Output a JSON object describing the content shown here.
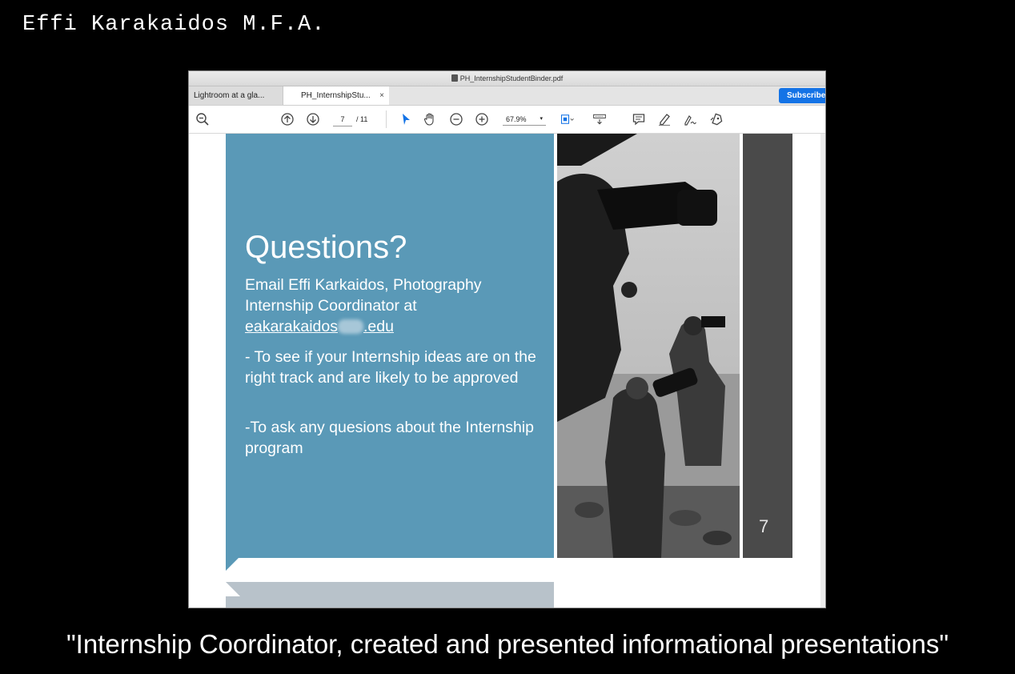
{
  "header_name": "Effi Karakaidos M.F.A.",
  "caption": "\"Internship Coordinator, created and presented informational presentations\"",
  "window": {
    "title": "PH_InternshipStudentBinder.pdf",
    "tabs": [
      {
        "label": "Lightroom at a gla..."
      },
      {
        "label": "PH_InternshipStu...",
        "close": "×"
      }
    ],
    "subscribe_label": "Subscribe"
  },
  "toolbar": {
    "current_page": "7",
    "total_pages": "/ 11",
    "zoom": "67.9%",
    "zoom_dropdown": "▾"
  },
  "slide": {
    "title": "Questions?",
    "email_line_name": "Email Effi Karkaidos",
    "email_line_rest": ", Photography Internship Coordinator at",
    "email_prefix": "eakarakaidos",
    "email_suffix": ".edu",
    "bullet1": "- To see if your Internship ideas are on the right track and are likely to be approved",
    "bullet2": "-To ask any quesions about the Internship program",
    "page_number": "7"
  },
  "colors": {
    "panel_blue": "#5a99b7",
    "subscribe_blue": "#1473e6",
    "dark_bar": "#4a4a4a"
  },
  "icons": [
    "zoom-out-icon",
    "page-up-icon",
    "page-down-icon",
    "select-arrow-icon",
    "hand-icon",
    "zoom-minus-icon",
    "zoom-plus-icon",
    "fit-page-icon",
    "scroll-mode-icon",
    "comment-icon",
    "highlight-icon",
    "sign-icon",
    "share-icon"
  ]
}
